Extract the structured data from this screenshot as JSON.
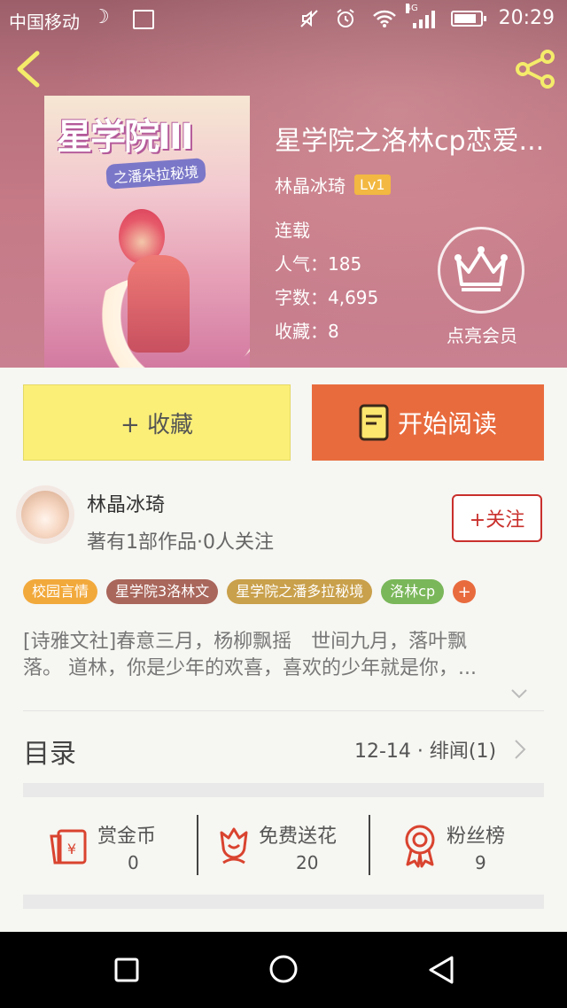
{
  "status": {
    "carrier": "中国移动",
    "network": "4G",
    "time": "20:29"
  },
  "book": {
    "title": "星学院之洛林cp恋爱...",
    "author": "林晶冰琦",
    "level": "Lv1",
    "state": "连载",
    "popularity": "人气：185",
    "word_count": "字数：4,695",
    "favorites": "收藏：8",
    "cover_logo": "星学院III",
    "cover_subtitle": "之潘朵拉秘境"
  },
  "vip": {
    "label": "点亮会员"
  },
  "actions": {
    "favorite_label": "+ 收藏",
    "read_label": "开始阅读"
  },
  "author_card": {
    "name": "林晶冰琦",
    "desc": "著有1部作品·0人关注",
    "follow_label": "+关注"
  },
  "tags": [
    {
      "label": "校园言情",
      "color": "#f2a93b"
    },
    {
      "label": "星学院3洛林文",
      "color": "#a9665b"
    },
    {
      "label": "星学院之潘多拉秘境",
      "color": "#c9a04b"
    },
    {
      "label": "洛林cp",
      "color": "#7ab75a"
    }
  ],
  "tag_add": "+",
  "description": {
    "line1": "[诗雅文社]春意三月，杨柳飘摇　世间九月，落叶飘",
    "line2": "落。 道林，你是少年的欢喜，喜欢的少年就是你，..."
  },
  "toc": {
    "label": "目录",
    "latest": "12-14 · 绯闻(1)"
  },
  "stats": [
    {
      "label": "赏金币",
      "value": "0",
      "icon": "red-envelope-icon"
    },
    {
      "label": "免费送花",
      "value": "20",
      "icon": "flower-icon"
    },
    {
      "label": "粉丝榜",
      "value": "9",
      "icon": "medal-icon"
    }
  ],
  "colors": {
    "accent_orange": "#e86b3e",
    "favorite_yellow": "#fbef78",
    "follow_red": "#c9302c",
    "icon_red": "#d9432f"
  }
}
